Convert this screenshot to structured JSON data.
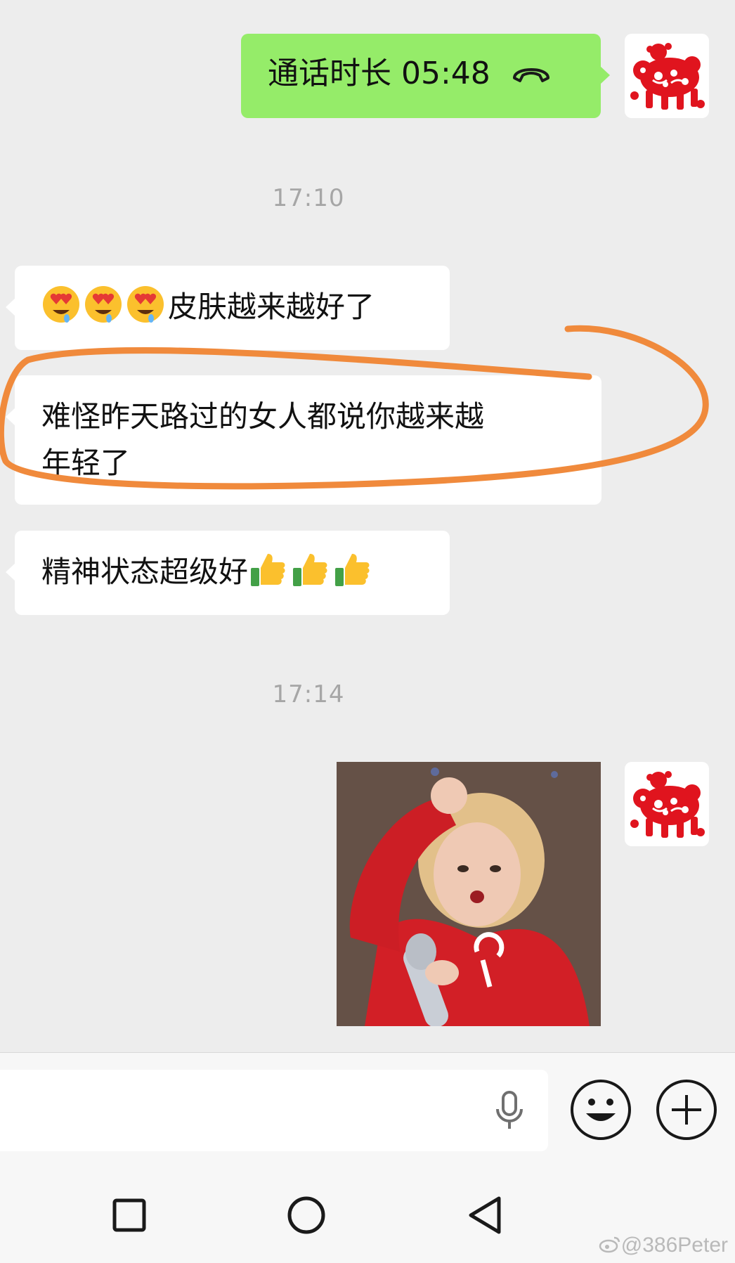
{
  "chat": {
    "call_record": {
      "text": "通话时长 05:48",
      "icon": "hang-up-phone-icon"
    },
    "timestamps": [
      "17:10",
      "17:14"
    ],
    "messages": [
      {
        "emojis": [
          "heart-eyes-drooling-emoji",
          "heart-eyes-drooling-emoji",
          "heart-eyes-drooling-emoji"
        ],
        "text": "皮肤越来越好了"
      },
      {
        "line1": "难怪昨天路过的女人都说你越来越",
        "line2": "年轻了"
      },
      {
        "text": "精神状态超级好",
        "emojis": [
          "thumbs-up-emoji",
          "thumbs-up-emoji",
          "thumbs-up-emoji"
        ]
      }
    ],
    "sticker": "girl-with-microphone-sticker",
    "avatar": "red-papercut-avatar"
  },
  "annotation": {
    "shape": "orange-freehand-circle",
    "color": "#f08a3c"
  },
  "input_bar": {
    "icons": [
      "microphone-icon",
      "emoji-icon",
      "plus-icon"
    ]
  },
  "nav_bar": {
    "icons": [
      "recent-apps-square-icon",
      "home-circle-icon",
      "back-triangle-icon"
    ]
  },
  "watermark": {
    "text": "@386Peter",
    "icon": "weibo-icon"
  },
  "colors": {
    "sent_bubble": "#95ec69",
    "received_bubble": "#ffffff",
    "chat_background": "#ededed",
    "avatar_red": "#e0141e"
  }
}
